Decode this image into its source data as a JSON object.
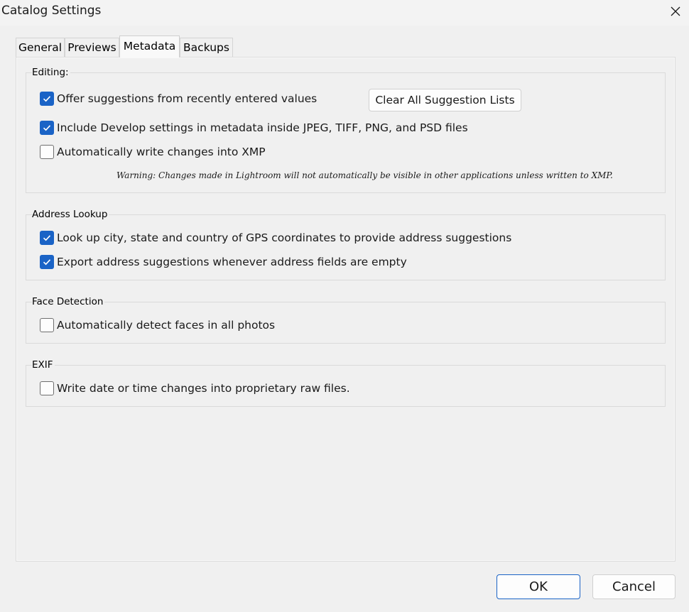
{
  "window": {
    "title": "Catalog Settings"
  },
  "tabs": [
    {
      "label": "General"
    },
    {
      "label": "Previews"
    },
    {
      "label": "Metadata"
    },
    {
      "label": "Backups"
    }
  ],
  "editing": {
    "label": "Editing:",
    "offer_suggestions": {
      "label": "Offer suggestions from recently entered values",
      "checked": true
    },
    "clear_suggestions_button": "Clear All Suggestion Lists",
    "include_develop": {
      "label": "Include Develop settings in metadata inside JPEG, TIFF, PNG, and PSD files",
      "checked": true
    },
    "auto_write_xmp": {
      "label": "Automatically write changes into XMP",
      "checked": false
    },
    "warning": "Warning: Changes made in Lightroom will not automatically be visible in other applications unless written to XMP."
  },
  "address_lookup": {
    "label": "Address Lookup",
    "lookup_city": {
      "label": "Look up city, state and country of GPS coordinates to provide address suggestions",
      "checked": true
    },
    "export_address": {
      "label": "Export address suggestions whenever address fields are empty",
      "checked": true
    }
  },
  "face_detection": {
    "label": "Face Detection",
    "auto_detect": {
      "label": "Automatically detect faces in all photos",
      "checked": false
    }
  },
  "exif": {
    "label": "EXIF",
    "write_date": {
      "label": "Write date or time changes into proprietary raw files.",
      "checked": false
    }
  },
  "footer": {
    "ok_label": "OK",
    "cancel_label": "Cancel"
  },
  "colors": {
    "accent": "#1a63c6",
    "background": "#f0f0f0"
  }
}
